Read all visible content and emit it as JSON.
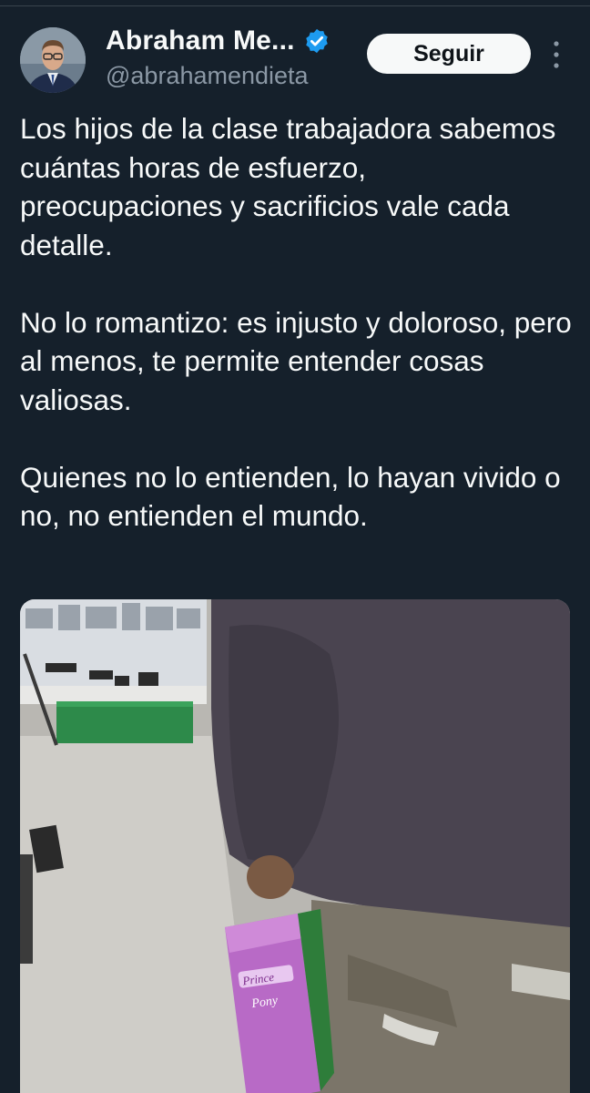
{
  "author": {
    "display_name": "Abraham Me...",
    "handle": "@abrahamendieta",
    "verified": true
  },
  "actions": {
    "follow_label": "Seguir"
  },
  "tweet": {
    "paragraphs": [
      "Los hijos de la clase trabajadora sabemos cuántas horas de esfuerzo, preocupaciones y sacrificios vale cada detalle.",
      "No lo romantizo: es injusto y doloroso, pero al menos, te permite entender cosas valiosas.",
      "Quienes no lo entienden, lo hayan vivido o no, no entienden el mundo."
    ]
  },
  "media": {
    "box_text_1": "Prince",
    "box_text_2": "Pony"
  },
  "colors": {
    "background": "#15202b",
    "text": "#f7f9f9",
    "secondary_text": "#8b98a5",
    "verified": "#1d9bf0",
    "follow_bg": "#f7f9f9"
  },
  "icons": {
    "verified": "verified-badge-icon",
    "more": "more-vertical-icon"
  }
}
